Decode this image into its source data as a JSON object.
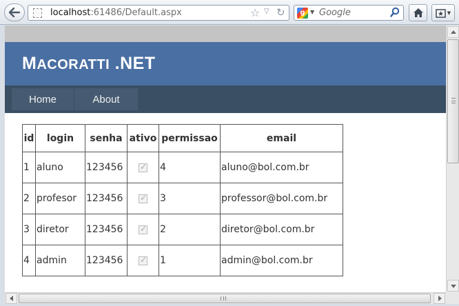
{
  "browser": {
    "url_host": "localhost",
    "url_rest": ":61486/Default.aspx",
    "search_placeholder": "Google",
    "icons": {
      "back": "back-arrow-icon",
      "page": "page-icon",
      "bookmark_star": "star-icon",
      "dropdown": "chevron-down-icon",
      "reload": "reload-icon",
      "search_engine": "google-icon",
      "search_go": "magnifier-icon",
      "home": "home-icon",
      "bookmarks": "bookmarks-icon"
    }
  },
  "site": {
    "title_big_1": "M",
    "title_small_1": "ACORATTI",
    "title_big_2": " .NET",
    "menu": [
      {
        "label": "Home"
      },
      {
        "label": "About"
      }
    ]
  },
  "grid": {
    "columns": [
      "id",
      "login",
      "senha",
      "ativo",
      "permissao",
      "email"
    ],
    "rows": [
      {
        "id": "1",
        "login": "aluno",
        "senha": "123456",
        "ativo": true,
        "permissao": "4",
        "email": "aluno@bol.com.br"
      },
      {
        "id": "2",
        "login": "profesor",
        "senha": "123456",
        "ativo": true,
        "permissao": "3",
        "email": "professor@bol.com.br"
      },
      {
        "id": "3",
        "login": "diretor",
        "senha": "123456",
        "ativo": true,
        "permissao": "2",
        "email": "diretor@bol.com.br"
      },
      {
        "id": "4",
        "login": "admin",
        "senha": "123456",
        "ativo": true,
        "permissao": "1",
        "email": "admin@bol.com.br"
      }
    ]
  },
  "colors": {
    "header_bg": "#4a6fa3",
    "menu_bg": "#3a4f63",
    "menu_item_bg": "#465b71"
  }
}
